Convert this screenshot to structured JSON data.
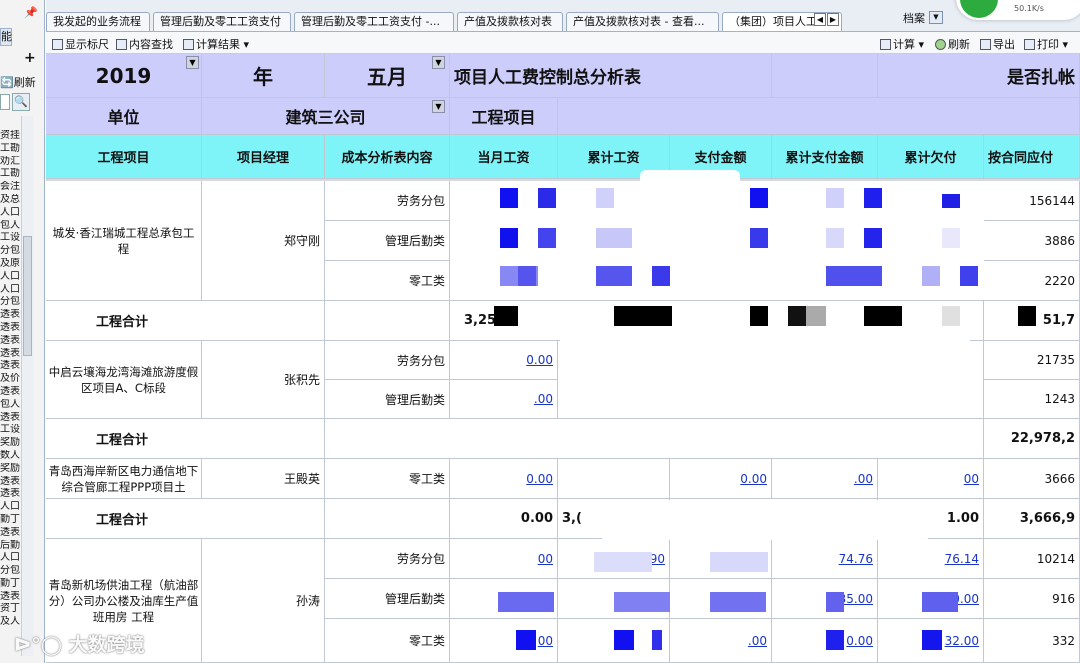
{
  "sidebar": {
    "pin_icon": "pin-icon",
    "tab_fragment": "能",
    "add": "+",
    "refresh_label": "刷新",
    "tree_items": [
      "资挂",
      "工勘",
      "劝汇总",
      "工勘",
      "会注",
      "及总",
      "人口",
      "包人",
      "工设",
      "分包",
      "及原",
      "人口",
      "人口",
      "分包",
      "透表",
      "透表",
      "透表",
      "透表",
      "透表",
      "及价",
      "透表",
      "包人",
      "透表",
      "工设",
      "奖励",
      "数人",
      "奖励",
      "透表",
      "透表",
      "人口",
      "勤丁",
      "透表",
      "后勤",
      "人口",
      "分包",
      "勤丁",
      "透表",
      "资丁",
      "及人"
    ]
  },
  "tabs": [
    {
      "label": "我发起的业务流程"
    },
    {
      "label": "管理后勤及零工工资支付"
    },
    {
      "label": "管理后勤及零工工资支付 -..."
    },
    {
      "label": "产值及拨款核对表"
    },
    {
      "label": "产值及拨款核对表 - 查看..."
    },
    {
      "label": "（集团）项目人工"
    }
  ],
  "tab_nav": {
    "prev": "◀",
    "next": "▶"
  },
  "archive": {
    "label": "档案",
    "selector": "▼"
  },
  "network": {
    "speed": "50.1K/s"
  },
  "toolbar": {
    "show_ruler": "显示标尺",
    "content_search": "内容查找",
    "calc_result": "计算结果",
    "calc": "计算",
    "refresh": "刷新",
    "export": "导出",
    "print": "打印"
  },
  "header": {
    "year": "2019",
    "year_unit": "年",
    "month": "五月",
    "report_title": "项目人工费控制总分析表",
    "posted_label": "是否扎帐",
    "unit_label": "单位",
    "unit_value": "建筑三公司",
    "project_label": "工程项目"
  },
  "columns": [
    "工程项目",
    "项目经理",
    "成本分析表内容",
    "当月工资",
    "累计工资",
    "支付金额",
    "累计支付金额",
    "累计欠付",
    "按合同应付"
  ],
  "groups": [
    {
      "project": "城发·香江瑞城工程总承包工程",
      "manager": "郑守刚",
      "rows": [
        {
          "category": "劳务分包",
          "contract": "156144"
        },
        {
          "category": "管理后勤类",
          "contract": "3886"
        },
        {
          "category": "零工类",
          "contract": "2220"
        }
      ],
      "subtotal": {
        "label": "工程合计",
        "monthly": "3,25",
        "contract": "51,7"
      }
    },
    {
      "project": "中启云壤海龙湾海滩旅游度假区项目A、C标段",
      "manager": "张积先",
      "rows": [
        {
          "category": "劳务分包",
          "monthly": "0.00",
          "contract": "21735"
        },
        {
          "category": "管理后勤类",
          "monthly": ".00",
          "contract": "1243"
        }
      ],
      "subtotal": {
        "label": "工程合计",
        "contract": "22,978,2"
      }
    },
    {
      "project": "青岛西海岸新区电力通信地下综合管廊工程PPP项目土",
      "manager": "王殿英",
      "rows": [
        {
          "category": "零工类",
          "monthly": "0.00",
          "paid": "0.00",
          "cum_paid": ".00",
          "arrears": "00",
          "contract": "3666"
        }
      ],
      "subtotal": {
        "label": "工程合计",
        "monthly": "0.00",
        "cumulative": "3,(",
        "arrears": "1.00",
        "contract": "3,666,9"
      }
    },
    {
      "project": "青岛新机场供油工程（航油部分）公司办公楼及油库生产值班用房 工程",
      "manager": "孙涛",
      "rows": [
        {
          "category": "劳务分包",
          "monthly": "00",
          "cumulative": ".90",
          "cum_paid": "74.76",
          "arrears": "76.14",
          "contract": "10214"
        },
        {
          "category": "管理后勤类",
          "monthly": "00",
          "cum_paid": "35.00",
          "arrears": "500.00",
          "contract": "916"
        },
        {
          "category": "零工类",
          "monthly": "00",
          "paid": ".00",
          "cum_paid": "0.00",
          "arrears": "32.00",
          "contract": "332"
        }
      ]
    }
  ],
  "watermark": "大数跨境"
}
